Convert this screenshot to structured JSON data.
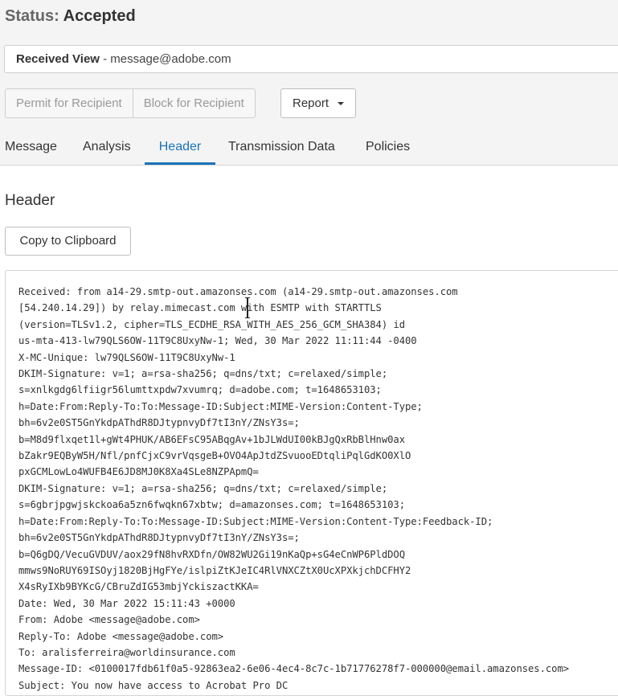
{
  "status": {
    "label": "Status:",
    "value": "Accepted"
  },
  "received_view": {
    "title": "Received View",
    "separator": " - ",
    "address": "message@adobe.com"
  },
  "actions": {
    "permit": "Permit for Recipient",
    "block": "Block for Recipient",
    "report": "Report"
  },
  "tabs": [
    {
      "label": "Message"
    },
    {
      "label": "Analysis"
    },
    {
      "label": "Header",
      "active": true
    },
    {
      "label": "Transmission Data"
    },
    {
      "label": "Policies"
    }
  ],
  "section": {
    "title": "Header",
    "copy_label": "Copy to Clipboard"
  },
  "header_lines": [
    "Received: from a14-29.smtp-out.amazonses.com (a14-29.smtp-out.amazonses.com",
    "[54.240.14.29]) by relay.mimecast.com with ESMTP with STARTTLS",
    "(version=TLSv1.2, cipher=TLS_ECDHE_RSA_WITH_AES_256_GCM_SHA384) id",
    "us-mta-413-lw79QLS6OW-11T9C8UxyNw-1; Wed, 30 Mar 2022 11:11:44 -0400",
    "X-MC-Unique: lw79QLS6OW-11T9C8UxyNw-1",
    "DKIM-Signature: v=1; a=rsa-sha256; q=dns/txt; c=relaxed/simple;",
    "s=xnlkgdg6lfiigr56lumttxpdw7xvumrq; d=adobe.com; t=1648653103;",
    "h=Date:From:Reply-To:To:Message-ID:Subject:MIME-Version:Content-Type;",
    "bh=6v2e0ST5GnYkdpAThdR8DJtypnvyDf7tI3nY/ZNsY3s=;",
    "b=M8d9flxqet1l+gWt4PHUK/AB6EFsC95ABqgAv+1bJLWdUI00kBJgQxRbBlHnw0ax",
    "bZakr9EQByW5H/Nfl/pnfCjxC9vrVqsgeB+OVO4ApJtdZSvuooEDtqliPqlGdKO0XlO",
    "pxGCMLowLo4WUFB4E6JD8MJ0K8Xa4SLe8NZPApmQ=",
    "DKIM-Signature: v=1; a=rsa-sha256; q=dns/txt; c=relaxed/simple;",
    "s=6gbrjpgwjskckoa6a5zn6fwqkn67xbtw; d=amazonses.com; t=1648653103;",
    "h=Date:From:Reply-To:To:Message-ID:Subject:MIME-Version:Content-Type:Feedback-ID;",
    "bh=6v2e0ST5GnYkdpAThdR8DJtypnvyDf7tI3nY/ZNsY3s=;",
    "b=Q6gDQ/VecuGVDUV/aox29fN8hvRXDfn/OW82WU2Gi19nKaQp+sG4eCnWP6PldDOQ",
    "mmws9NoRUY69ISOyj1820BjHgFYe/islpiZtKJeIC4RlVNXCZtX0UcXPXkjchDCFHY2",
    "X4sRyIXb9BYKcG/CBruZdIG53mbjYckiszactKKA=",
    "Date: Wed, 30 Mar 2022 15:11:43 +0000",
    "From: Adobe <message@adobe.com>",
    "Reply-To: Adobe <message@adobe.com>",
    "To: aralisferreira@worldinsurance.com",
    "Message-ID: <0100017fdb61f0a5-92863ea2-6e06-4ec4-8c7c-1b71776278f7-000000@email.amazonses.com>",
    "Subject: You now have access to Acrobat Pro DC"
  ]
}
